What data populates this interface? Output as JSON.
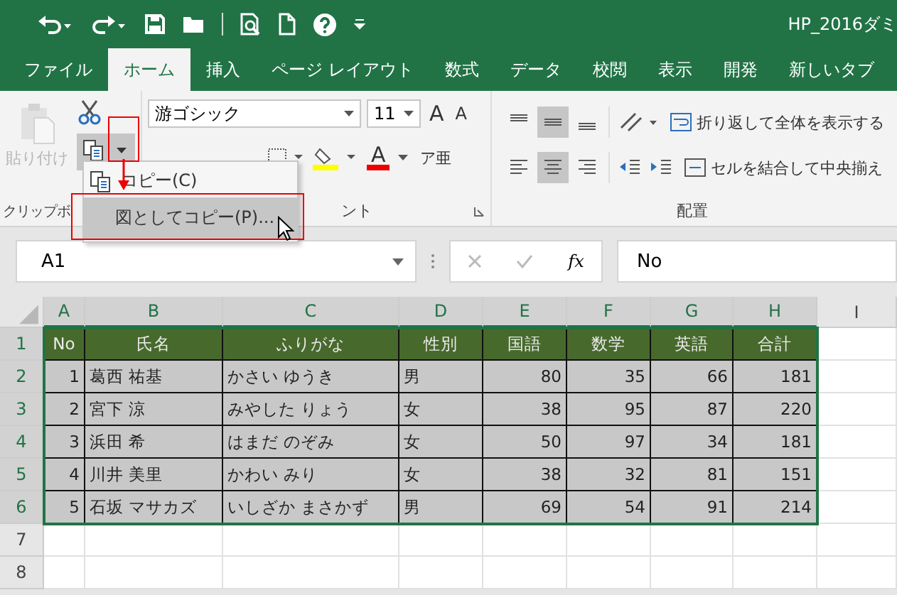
{
  "title_bar": {
    "title": "HP_2016ダミ"
  },
  "tabs": [
    {
      "label": "ファイル",
      "selected": false
    },
    {
      "label": "ホーム",
      "selected": true
    },
    {
      "label": "挿入",
      "selected": false
    },
    {
      "label": "ページ レイアウト",
      "selected": false
    },
    {
      "label": "数式",
      "selected": false
    },
    {
      "label": "データ",
      "selected": false
    },
    {
      "label": "校閲",
      "selected": false
    },
    {
      "label": "表示",
      "selected": false
    },
    {
      "label": "開発",
      "selected": false
    },
    {
      "label": "新しいタブ",
      "selected": false
    }
  ],
  "ribbon": {
    "clipboard": {
      "paste": {
        "label": "貼り付け",
        "disabled": true
      },
      "group_label": "クリップボ"
    },
    "font": {
      "name": "游ゴシック",
      "size": "11",
      "grow": "A",
      "shrink": "A",
      "color_label": "A",
      "phonetic": "ア亜",
      "group_label": "ント"
    },
    "alignment": {
      "vertical": [
        {
          "selected": false
        },
        {
          "selected": true
        },
        {
          "selected": false
        }
      ],
      "horizontal": [
        {
          "selected": false
        },
        {
          "selected": true
        },
        {
          "selected": false
        }
      ],
      "wrap_text": "折り返して全体を表示する",
      "merge": "セルを結合して中央揃え",
      "group_label": "配置"
    }
  },
  "copy_menu": {
    "items": [
      {
        "label": "コピー(C)",
        "selected": false
      },
      {
        "label": "図としてコピー(P)...",
        "selected": true
      }
    ]
  },
  "formula_bar": {
    "name_box": "A1",
    "function_label": "fx",
    "formula": "No"
  },
  "sheet": {
    "columns": [
      {
        "label": "A",
        "selected": true
      },
      {
        "label": "B",
        "selected": true
      },
      {
        "label": "C",
        "selected": true
      },
      {
        "label": "D",
        "selected": true
      },
      {
        "label": "E",
        "selected": true
      },
      {
        "label": "F",
        "selected": true
      },
      {
        "label": "G",
        "selected": true
      },
      {
        "label": "H",
        "selected": true
      },
      {
        "label": "I",
        "selected": false
      }
    ],
    "rows": [
      {
        "number": "1",
        "kind": "header",
        "selected": true,
        "cells": [
          "No",
          "氏名",
          "ふりがな",
          "性別",
          "国語",
          "数学",
          "英語",
          "合計"
        ]
      },
      {
        "number": "2",
        "kind": "data",
        "selected": true,
        "cells": [
          "1",
          "葛西 祐基",
          "かさい ゆうき",
          "男",
          "80",
          "35",
          "66",
          "181"
        ]
      },
      {
        "number": "3",
        "kind": "data",
        "selected": true,
        "cells": [
          "2",
          "宮下 涼",
          "みやした りょう",
          "女",
          "38",
          "95",
          "87",
          "220"
        ]
      },
      {
        "number": "4",
        "kind": "data",
        "selected": true,
        "cells": [
          "3",
          "浜田 希",
          "はまだ のぞみ",
          "女",
          "50",
          "97",
          "34",
          "181"
        ]
      },
      {
        "number": "5",
        "kind": "data",
        "selected": true,
        "cells": [
          "4",
          "川井 美里",
          "かわい みり",
          "女",
          "38",
          "32",
          "81",
          "151"
        ]
      },
      {
        "number": "6",
        "kind": "data",
        "selected": true,
        "cells": [
          "5",
          "石坂 マサカズ",
          "いしざか まさかず",
          "男",
          "69",
          "54",
          "91",
          "214"
        ]
      },
      {
        "number": "7",
        "kind": "empty",
        "selected": false
      },
      {
        "number": "8",
        "kind": "empty",
        "selected": false
      }
    ]
  }
}
